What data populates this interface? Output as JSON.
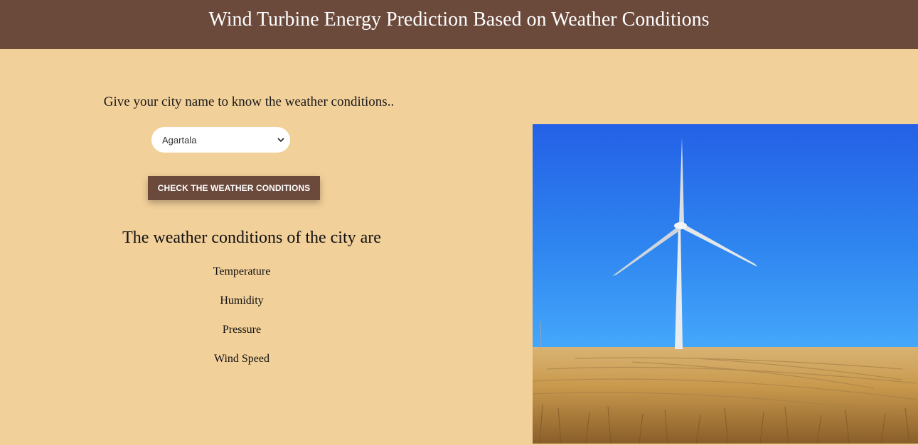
{
  "header": {
    "title": "Wind Turbine Energy Prediction Based on Weather Conditions"
  },
  "form": {
    "prompt": "Give your city name to know the weather conditions..",
    "city_selected": "Agartala",
    "submit_label": "CHECK THE WEATHER CONDITIONS"
  },
  "results": {
    "title": "The weather conditions of the city are",
    "metrics": [
      "Temperature",
      "Humidity",
      "Pressure",
      "Wind Speed"
    ]
  },
  "image": {
    "subject": "wind turbine in wheat field under blue sky"
  },
  "colors": {
    "background": "#f2d09a",
    "header": "#6b4a3c",
    "button": "#6b4a3c",
    "sky": "#2f86f0",
    "field": "#c79a4c"
  },
  "icons": {
    "select_chevron": "chevron-down-icon"
  }
}
